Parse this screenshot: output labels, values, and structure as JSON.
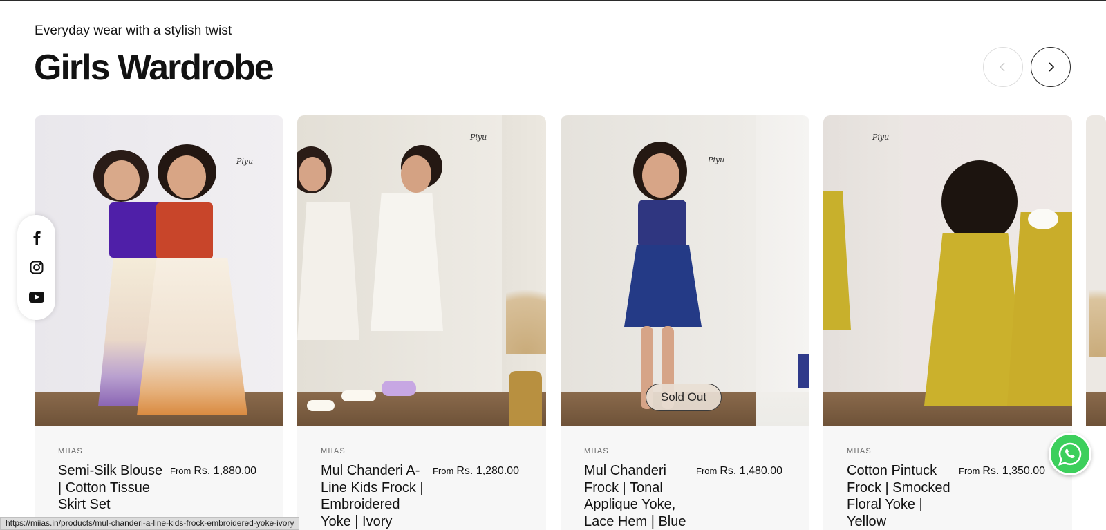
{
  "section": {
    "eyebrow": "Everyday wear with a stylish twist",
    "title": "Girls Wardrobe"
  },
  "carousel": {
    "prev_icon": "chevron-left-icon",
    "next_icon": "chevron-right-icon"
  },
  "products": [
    {
      "vendor": "MIIAS",
      "name": "Semi-Silk Blouse | Cotton Tissue Skirt Set",
      "price_prefix": "From",
      "price": "Rs. 1,880.00",
      "badge": ""
    },
    {
      "vendor": "MIIAS",
      "name": "Mul Chanderi A-Line Kids Frock | Embroidered Yoke | Ivory",
      "price_prefix": "From",
      "price": "Rs. 1,280.00",
      "badge": ""
    },
    {
      "vendor": "MIIAS",
      "name": "Mul Chanderi Frock | Tonal Applique Yoke, Lace Hem | Blue",
      "price_prefix": "From",
      "price": "Rs. 1,480.00",
      "badge": "Sold Out"
    },
    {
      "vendor": "MIIAS",
      "name": "Cotton Pintuck Frock | Smocked Floral Yoke | Yellow",
      "price_prefix": "From",
      "price": "Rs. 1,350.00",
      "badge": ""
    }
  ],
  "photo_logo": "Piyu",
  "social": [
    "facebook-icon",
    "instagram-icon",
    "youtube-icon"
  ],
  "whatsapp_icon": "whatsapp-icon",
  "status_url": "https://miias.in/products/mul-chanderi-a-line-kids-frock-embroidered-yoke-ivory",
  "colors": {
    "text": "#121212",
    "info_bg": "#f7f7f7",
    "whatsapp": "#3ccf5c"
  }
}
